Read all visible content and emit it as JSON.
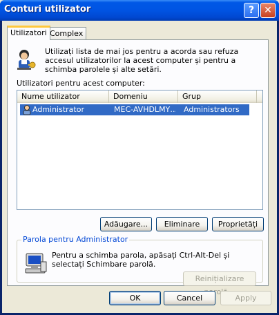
{
  "window": {
    "title": "Conturi utilizator",
    "help_glyph": "?",
    "close_glyph": "✕"
  },
  "tabs": [
    {
      "label": "Utilizatori",
      "active": true
    },
    {
      "label": "Complex",
      "active": false
    }
  ],
  "intro_text": "Utilizați lista de mai jos pentru a acorda sau refuza accesul utilizatorilor la acest computer și pentru a schimba parolele și alte setări.",
  "list_label": "Utilizatori pentru acest computer:",
  "listview": {
    "columns": [
      "Nume utilizator",
      "Domeniu",
      "Grup"
    ],
    "rows": [
      {
        "name": "Administrator",
        "domain": "MEC-AVHDLMY…",
        "group": "Administrators",
        "selected": true
      }
    ]
  },
  "buttons": {
    "add": "Adăugare...",
    "remove": "Eliminare",
    "properties": "Proprietăți"
  },
  "password_group": {
    "legend": "Parola pentru Administrator",
    "text": "Pentru a schimba parola, apăsați Ctrl-Alt-Del și selectați Schimbare parolă.",
    "reset_button": "Reinițializare parolă..."
  },
  "footer": {
    "ok": "OK",
    "cancel": "Cancel",
    "apply": "Apply"
  },
  "colors": {
    "title_blue": "#0054e3",
    "selection": "#316ac5",
    "legend_blue": "#0046d5"
  }
}
